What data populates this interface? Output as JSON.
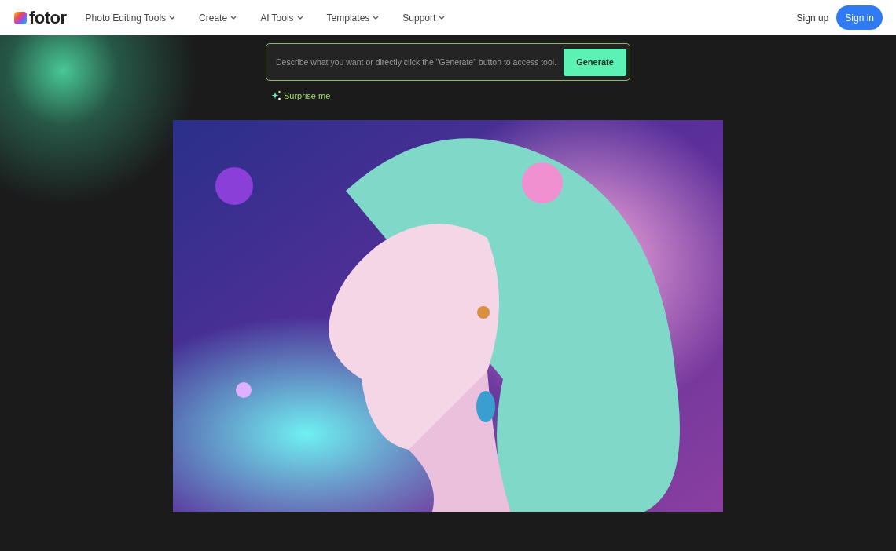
{
  "header": {
    "logo": "fotor",
    "nav": [
      {
        "label": "Photo Editing Tools"
      },
      {
        "label": "Create"
      },
      {
        "label": "AI Tools"
      },
      {
        "label": "Templates"
      },
      {
        "label": "Support"
      }
    ],
    "sign_up": "Sign up",
    "sign_in": "Sign in"
  },
  "prompt": {
    "placeholder": "Describe what you want or directly click the \"Generate\" button to access tool.",
    "button": "Generate",
    "surprise": "Surprise me"
  }
}
